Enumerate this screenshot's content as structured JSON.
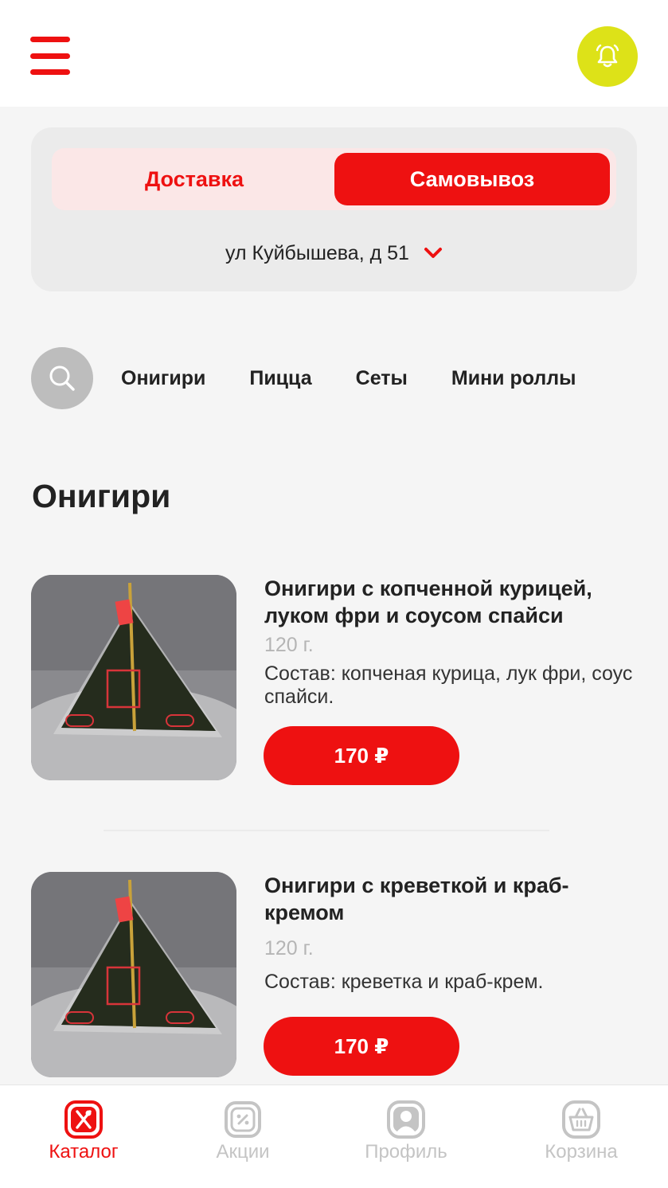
{
  "header": {
    "menu_icon": "hamburger-menu-icon",
    "bell_icon": "bell-icon",
    "colors": {
      "accent": "#ee1111",
      "bell_bg": "#dde218"
    }
  },
  "delivery": {
    "options": {
      "delivery": "Доставка",
      "pickup": "Самовывоз"
    },
    "selected": "pickup",
    "address": "ул Куйбышева, д 51",
    "address_icon": "chevron-down-icon"
  },
  "categories": {
    "search_icon": "search-icon",
    "items": [
      "Онигири",
      "Пицца",
      "Сеты",
      "Мини роллы"
    ]
  },
  "section": {
    "title": "Онигири"
  },
  "products": [
    {
      "name": "Онигири с копченной курицей, луком фри и соусом спайси",
      "weight": "120 г.",
      "description": "Состав: копченая курица, лук фри, соус спайси.",
      "price": "170 ₽"
    },
    {
      "name": "Онигири с креветкой и краб-кремом",
      "weight": "120 г.",
      "description": "Состав: креветка и краб-крем.",
      "price": "170 ₽"
    }
  ],
  "tabbar": {
    "tabs": [
      {
        "label": "Каталог",
        "icon": "catalog-fork-knife-icon",
        "active": true
      },
      {
        "label": "Акции",
        "icon": "discount-icon",
        "active": false
      },
      {
        "label": "Профиль",
        "icon": "profile-icon",
        "active": false
      },
      {
        "label": "Корзина",
        "icon": "basket-icon",
        "active": false
      }
    ]
  }
}
